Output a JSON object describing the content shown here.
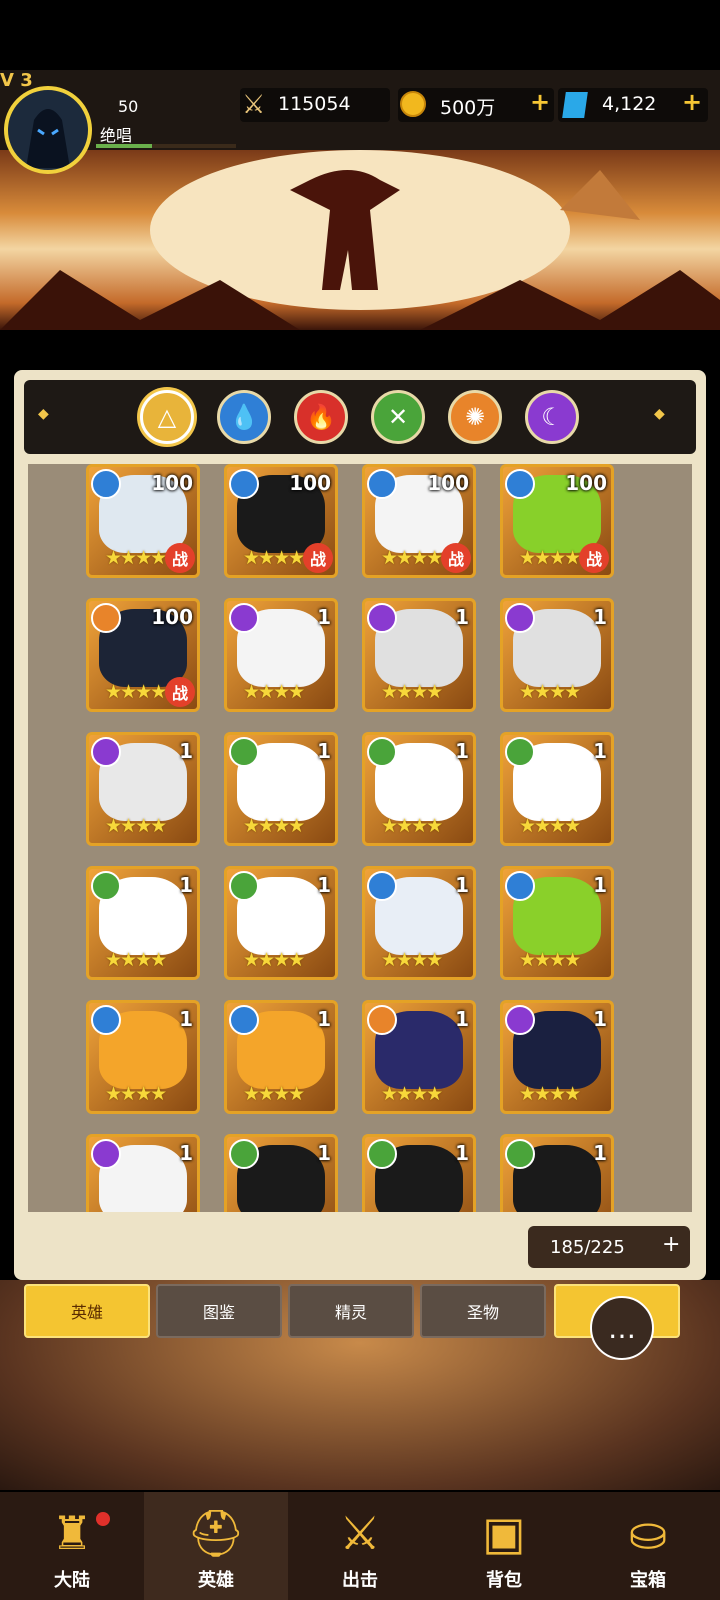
{
  "header": {
    "vip_label": "V 3",
    "level": "50",
    "player_name": "绝唱",
    "power": "115054",
    "gold": "500万",
    "gems": "4,122",
    "xp_fraction": 0.4
  },
  "element_tabs": [
    {
      "name": "all",
      "icon": "triangle-icon",
      "color": "#e8b43a"
    },
    {
      "name": "water",
      "icon": "water-drop-icon",
      "color": "#2f7fd6"
    },
    {
      "name": "fire",
      "icon": "flame-icon",
      "color": "#d8302a"
    },
    {
      "name": "wind",
      "icon": "leaf-icon",
      "color": "#4aa43a"
    },
    {
      "name": "sun",
      "icon": "spiral-icon",
      "color": "#e8842a"
    },
    {
      "name": "moon",
      "icon": "moon-icon",
      "color": "#8a3ad0"
    }
  ],
  "heroes": [
    {
      "element": "water",
      "level": "100",
      "tag": "战",
      "art": "#dfe8f0"
    },
    {
      "element": "water",
      "level": "100",
      "tag": "战",
      "art": "#1a1a1a"
    },
    {
      "element": "water",
      "level": "100",
      "tag": "战",
      "art": "#f4f4f4"
    },
    {
      "element": "water",
      "level": "100",
      "tag": "战",
      "art": "#88d02a"
    },
    {
      "element": "sun",
      "level": "100",
      "tag": "战",
      "art": "#1c2436"
    },
    {
      "element": "moon",
      "level": "1",
      "tag": "",
      "art": "#f4f4f4"
    },
    {
      "element": "moon",
      "level": "1",
      "tag": "",
      "art": "#e0e0e0"
    },
    {
      "element": "moon",
      "level": "1",
      "tag": "",
      "art": "#e0e0e0"
    },
    {
      "element": "moon",
      "level": "1",
      "tag": "",
      "art": "#e8e8e8"
    },
    {
      "element": "wind",
      "level": "1",
      "tag": "",
      "art": "#ffffff"
    },
    {
      "element": "wind",
      "level": "1",
      "tag": "",
      "art": "#ffffff"
    },
    {
      "element": "wind",
      "level": "1",
      "tag": "",
      "art": "#ffffff"
    },
    {
      "element": "wind",
      "level": "1",
      "tag": "",
      "art": "#ffffff"
    },
    {
      "element": "wind",
      "level": "1",
      "tag": "",
      "art": "#ffffff"
    },
    {
      "element": "water",
      "level": "1",
      "tag": "",
      "art": "#e8eef6"
    },
    {
      "element": "water",
      "level": "1",
      "tag": "",
      "art": "#8ad02a"
    },
    {
      "element": "water",
      "level": "1",
      "tag": "",
      "art": "#f4a52a"
    },
    {
      "element": "water",
      "level": "1",
      "tag": "",
      "art": "#f4a52a"
    },
    {
      "element": "sun",
      "level": "1",
      "tag": "",
      "art": "#2a2a6a"
    },
    {
      "element": "moon",
      "level": "1",
      "tag": "",
      "art": "#1a2040"
    },
    {
      "element": "moon",
      "level": "1",
      "tag": "",
      "art": "#f4f4f4"
    },
    {
      "element": "wind",
      "level": "1",
      "tag": "",
      "art": "#1a1a1a"
    },
    {
      "element": "wind",
      "level": "1",
      "tag": "",
      "art": "#1a1a1a"
    },
    {
      "element": "wind",
      "level": "1",
      "tag": "",
      "art": "#1a1a1a"
    }
  ],
  "stars": "★★★★",
  "hero_count": "185/225",
  "tabs": {
    "heroes": "英雄",
    "codex": "图鉴",
    "spirits": "精灵",
    "relics": "圣物"
  },
  "nav": {
    "continent": "大陆",
    "heroes": "英雄",
    "battle": "出击",
    "bag": "背包",
    "chest": "宝箱"
  }
}
